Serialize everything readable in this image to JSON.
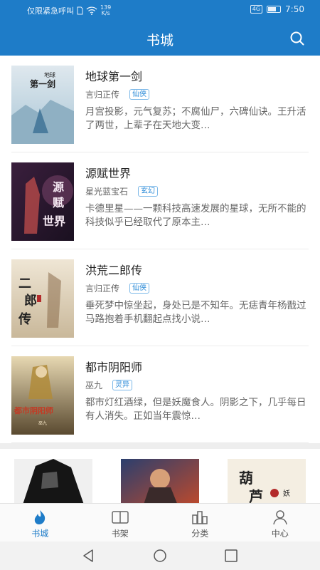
{
  "status_bar": {
    "carrier_text": "仅限紧急呼叫",
    "speed_value": "139",
    "speed_unit": "K/s",
    "network": "4G",
    "time": "7:50"
  },
  "header": {
    "title": "书城"
  },
  "books": [
    {
      "title": "地球第一剑",
      "author": "言归正传",
      "tag": "仙侠",
      "description": "月宫投影，元气复苏；不腐仙尸，六碑仙诀。王升活了两世，上辈子在天地大变…"
    },
    {
      "title": "源赋世界",
      "author": "星光蓝宝石",
      "tag": "玄幻",
      "description": "卡德里星——一颗科技高速发展的星球，无所不能的科技似乎已经取代了原本主…"
    },
    {
      "title": "洪荒二郎传",
      "author": "言归正传",
      "tag": "仙侠",
      "description": "垂死梦中惊坐起，身处已是不知年。无痣青年杨戬过马路抱着手机翻起点找小说…"
    },
    {
      "title": "都市阴阳师",
      "author": "巫九",
      "tag": "灵异",
      "description": "都市灯红酒绿，但是妖魔食人。阴影之下，几乎每日有人消失。正如当年震惊…"
    }
  ],
  "cover_art_text": [
    "地球",
    "第一剑",
    "源",
    "赋",
    "世界",
    "二",
    "郎",
    "传",
    "都市阴阳师",
    "巫九",
    "葫",
    "芦",
    "妖"
  ],
  "tabs": [
    {
      "label": "书城",
      "icon": "flame-icon",
      "active": true
    },
    {
      "label": "书架",
      "icon": "open-book-icon",
      "active": false
    },
    {
      "label": "分类",
      "icon": "grid-category-icon",
      "active": false
    },
    {
      "label": "中心",
      "icon": "user-icon",
      "active": false
    }
  ],
  "colors": {
    "brand": "#1e7cc8",
    "tag": "#2a8ad8"
  }
}
